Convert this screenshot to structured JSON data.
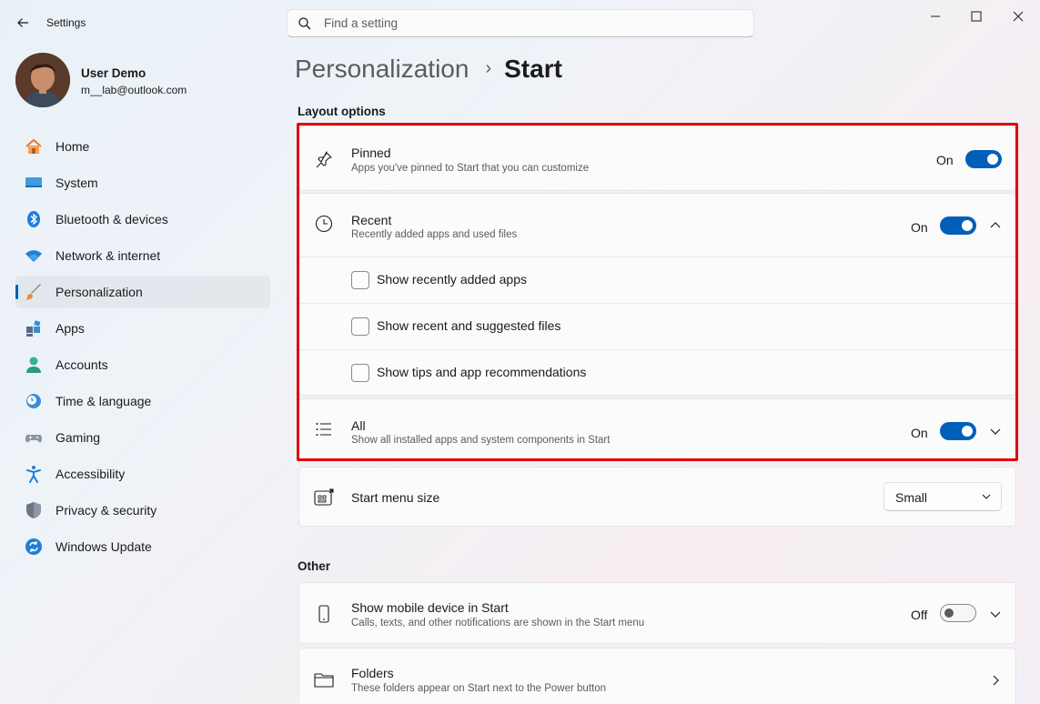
{
  "window": {
    "title": "Settings"
  },
  "search": {
    "placeholder": "Find a setting"
  },
  "user": {
    "name": "User Demo",
    "email": "m__lab@outlook.com"
  },
  "sidebar": {
    "items": [
      {
        "label": "Home",
        "icon": "home-icon"
      },
      {
        "label": "System",
        "icon": "system-icon"
      },
      {
        "label": "Bluetooth & devices",
        "icon": "bluetooth-icon"
      },
      {
        "label": "Network & internet",
        "icon": "wifi-icon"
      },
      {
        "label": "Personalization",
        "icon": "brush-icon",
        "active": true
      },
      {
        "label": "Apps",
        "icon": "apps-icon"
      },
      {
        "label": "Accounts",
        "icon": "accounts-icon"
      },
      {
        "label": "Time & language",
        "icon": "clock-globe-icon"
      },
      {
        "label": "Gaming",
        "icon": "gamepad-icon"
      },
      {
        "label": "Accessibility",
        "icon": "accessibility-icon"
      },
      {
        "label": "Privacy & security",
        "icon": "shield-icon"
      },
      {
        "label": "Windows Update",
        "icon": "update-icon"
      }
    ]
  },
  "breadcrumb": {
    "parent": "Personalization",
    "separator": "›",
    "current": "Start"
  },
  "layout_section": {
    "title": "Layout options",
    "pinned": {
      "title": "Pinned",
      "desc": "Apps you've pinned to Start that you can customize",
      "state": "On"
    },
    "recent": {
      "title": "Recent",
      "desc": "Recently added apps and used files",
      "state": "On",
      "options": [
        {
          "label": "Show recently added apps",
          "checked": false
        },
        {
          "label": "Show recent and suggested files",
          "checked": false
        },
        {
          "label": "Show tips and app recommendations",
          "checked": false
        }
      ]
    },
    "all": {
      "title": "All",
      "desc": "Show all installed apps and system components in Start",
      "state": "On"
    },
    "menu_size": {
      "title": "Start menu size",
      "value": "Small"
    }
  },
  "other_section": {
    "title": "Other",
    "mobile": {
      "title": "Show mobile device in Start",
      "desc": "Calls, texts, and other notifications are shown in the Start menu",
      "state": "Off"
    },
    "folders": {
      "title": "Folders",
      "desc": "These folders appear on Start next to the Power button"
    }
  },
  "colors": {
    "accent": "#005fb8",
    "highlight": "#e00000"
  }
}
